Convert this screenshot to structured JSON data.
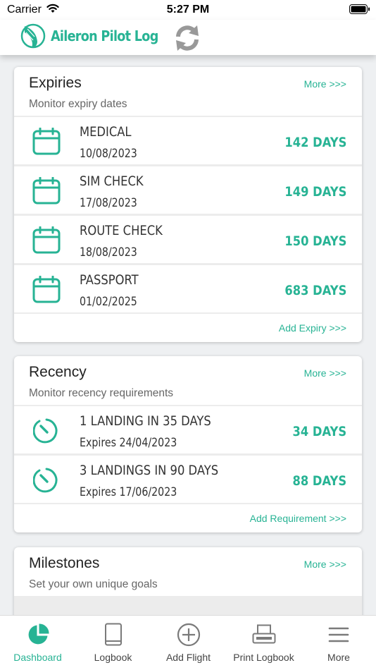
{
  "status_bar": {
    "carrier": "Carrier",
    "time": "5:27 PM"
  },
  "header": {
    "app_title": "Aileron Pilot Log"
  },
  "colors": {
    "accent": "#27b394",
    "text": "#333333",
    "muted": "#666666"
  },
  "expiries": {
    "title": "Expiries",
    "more": "More >>>",
    "subtitle": "Monitor expiry dates",
    "items": [
      {
        "name": "MEDICAL",
        "date": "10/08/2023",
        "days": "142 DAYS",
        "icon": "calendar-icon"
      },
      {
        "name": "SIM CHECK",
        "date": "17/08/2023",
        "days": "149 DAYS",
        "icon": "calendar-icon"
      },
      {
        "name": "ROUTE CHECK",
        "date": "18/08/2023",
        "days": "150 DAYS",
        "icon": "calendar-icon"
      },
      {
        "name": "PASSPORT",
        "date": "01/02/2025",
        "days": "683 DAYS",
        "icon": "calendar-icon"
      }
    ],
    "add_link": "Add Expiry >>>"
  },
  "recency": {
    "title": "Recency",
    "more": "More >>>",
    "subtitle": "Monitor recency requirements",
    "items": [
      {
        "name": "1 LANDING IN 35 DAYS",
        "date": "Expires 24/04/2023",
        "days": "34 DAYS",
        "icon": "timer-icon"
      },
      {
        "name": "3 LANDINGS IN 90 DAYS",
        "date": "Expires 17/06/2023",
        "days": "88 DAYS",
        "icon": "timer-icon"
      }
    ],
    "add_link": "Add Requirement >>>"
  },
  "milestones": {
    "title": "Milestones",
    "more": "More >>>",
    "subtitle": "Set your own unique goals"
  },
  "tabs": [
    {
      "label": "Dashboard",
      "icon": "pie-chart-icon",
      "active": true
    },
    {
      "label": "Logbook",
      "icon": "book-icon",
      "active": false
    },
    {
      "label": "Add Flight",
      "icon": "add-circle-icon",
      "active": false
    },
    {
      "label": "Print Logbook",
      "icon": "printer-icon",
      "active": false
    },
    {
      "label": "More",
      "icon": "menu-icon",
      "active": false
    }
  ]
}
